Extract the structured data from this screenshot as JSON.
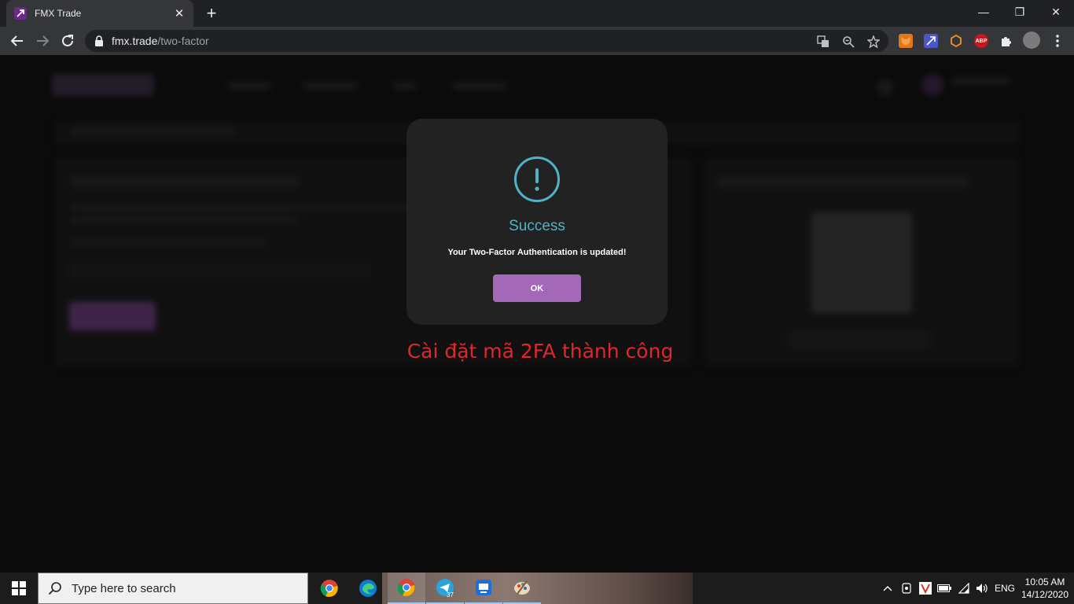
{
  "browser": {
    "tab_title": "FMX Trade",
    "tab_close": "✕",
    "new_tab": "+",
    "url_host": "fmx.trade",
    "url_path": "/two-factor",
    "window_minimize": "—",
    "window_restore": "❐",
    "window_close": "✕",
    "extensions": [
      {
        "name": "metamask-icon",
        "color": "#e2761b"
      },
      {
        "name": "cast-icon",
        "color": "#4a57c9"
      },
      {
        "name": "hex-icon",
        "color": "#c96a1a"
      },
      {
        "name": "abp-icon",
        "color": "#c4161c",
        "label": "ABP"
      }
    ]
  },
  "modal": {
    "title": "Success",
    "message": "Your Two-Factor Authentication is updated!",
    "ok_label": "OK",
    "accent": "#4fb3c8",
    "button_color": "#a468b8"
  },
  "annotation": "Cài đặt mã 2FA thành công",
  "taskbar": {
    "search_placeholder": "Type here to search",
    "telegram_badge": "37",
    "language": "ENG",
    "time": "10:05 AM",
    "date": "14/12/2020"
  }
}
